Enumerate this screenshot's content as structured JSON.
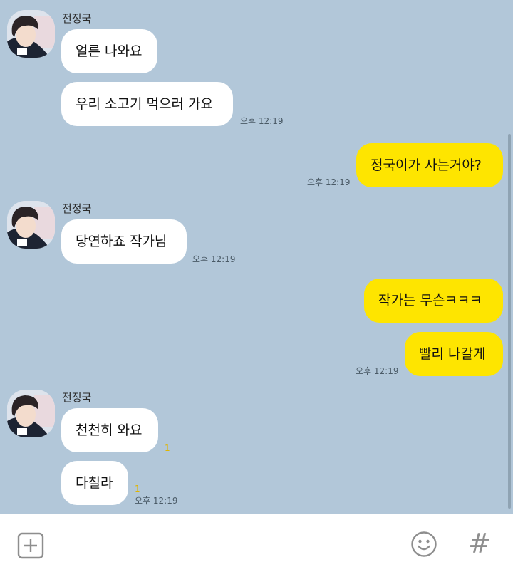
{
  "sender": {
    "name": "전정국",
    "avatar_icon": "profile-photo-icon"
  },
  "messages": [
    {
      "text": "얼른 나와요"
    },
    {
      "text": "우리 소고기 먹으러 가요",
      "time": "오후 12:19"
    },
    {
      "text": "정국이가 사는거야?",
      "time": "오후 12:19"
    },
    {
      "text": "당연하죠 작가님",
      "time": "오후 12:19"
    },
    {
      "text": "작가는 무슨ㅋㅋㅋ"
    },
    {
      "text": "빨리 나갈게",
      "time": "오후 12:19"
    },
    {
      "text": "천천히 와요",
      "unread": "1"
    },
    {
      "text": "다칠라",
      "unread": "1",
      "time": "오후 12:19"
    }
  ],
  "input_bar": {
    "add_icon": "plus-square-icon",
    "emoji_icon": "smiley-icon",
    "hashtag_icon": "hashtag-icon",
    "hashtag_label": "#"
  },
  "colors": {
    "background": "#b2c7d9",
    "incoming_bubble": "#ffffff",
    "outgoing_bubble": "#fee500",
    "unread_count": "#e0b500"
  }
}
